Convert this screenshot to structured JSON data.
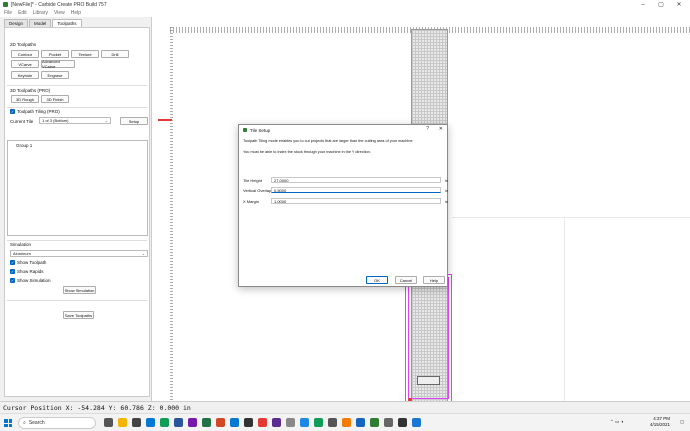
{
  "window": {
    "title": "[NewFile]* - Carbide Create PRO Build 757"
  },
  "menu": [
    "File",
    "Edit",
    "Library",
    "View",
    "Help"
  ],
  "tabs": [
    {
      "label": "Design"
    },
    {
      "label": "Model"
    },
    {
      "label": "Toolpaths"
    }
  ],
  "toolpaths_2d": {
    "heading": "2D Toolpaths",
    "buttons": [
      "Contour",
      "Pocket",
      "Texture",
      "Drill",
      "VCarve",
      "Advanced VCarve",
      "Keyhole",
      "Engrave"
    ]
  },
  "toolpaths_3d": {
    "heading": "3D Toolpaths (PRO)",
    "buttons": [
      "3D Rough",
      "3D Finish"
    ]
  },
  "tiling": {
    "checkbox_label": "Toolpath Tiling (PRO)",
    "current_tile_label": "Current Tile",
    "current_tile_value": "1 of 3 (Bottom)",
    "setup_label": "Setup"
  },
  "groups": {
    "items": [
      "Group 1"
    ]
  },
  "simulation": {
    "heading": "Simulation",
    "material": "Aluminum",
    "checks": [
      "Show Toolpath",
      "Show Rapids",
      "Show Simulation"
    ],
    "show_button": "Show Simulation",
    "save_button": "Save Toolpaths"
  },
  "dialog": {
    "title": "Tile Setup",
    "help": "?",
    "close": "✕",
    "line1": "Toolpath Tiling mode enables you to cut projects that are larger than the cutting area of your machine.",
    "line2": "You must be able to index the stock through your machine in the Y direction.",
    "fields": [
      {
        "label": "Tile Height",
        "value": "27.0000",
        "unit": "in"
      },
      {
        "label": "Vertical Overlap",
        "value": "0.5000",
        "unit": "in"
      },
      {
        "label": "X Margin",
        "value": "1.0000",
        "unit": "in"
      }
    ],
    "ok": "OK",
    "cancel": "Cancel",
    "help_button": "Help"
  },
  "status": {
    "cursor": "Cursor Position X:  -54.284 Y: 60.786 Z: 0.000 in"
  },
  "taskbar": {
    "search": "Search",
    "time": "4:37 PM",
    "date": "4/15/2021"
  },
  "colors": {
    "accent": "#0067c0",
    "toolpath": "#e040fb",
    "origin": "#e53935"
  }
}
